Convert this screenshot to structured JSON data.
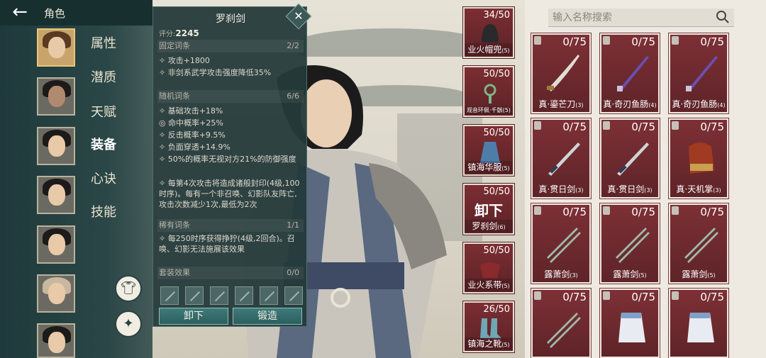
{
  "header": {
    "back_icon": "back-arrow-icon",
    "title": "角色"
  },
  "menu": [
    "属性",
    "潜质",
    "天赋",
    "装备",
    "心诀",
    "技能"
  ],
  "menu_active_index": 3,
  "round_buttons": [
    {
      "icon": "outfit-icon"
    },
    {
      "icon": "broom-icon"
    }
  ],
  "popup": {
    "title": "罗刹剑",
    "score_label": "评分:",
    "score": "2245",
    "fixed": {
      "label": "固定词条",
      "count": "2/2",
      "lines": [
        "攻击+1800",
        "非剑系武学攻击强度降低35%"
      ]
    },
    "random": {
      "label": "随机词条",
      "count": "6/6",
      "lines": [
        "基础攻击+18%",
        "命中概率+25%",
        "反击概率+9.5%",
        "负面穿透+14.9%",
        "50%的概率无视对方21%的防御强度",
        "每第4次攻击将造成诸般封印(4级,100时序)。每有一个非召唤、幻影队友阵亡,攻击次数减少1次,最低为2次"
      ]
    },
    "rare": {
      "label": "稀有词条",
      "count": "1/1",
      "lines": [
        "每250时序获得挣狞(4级,2回合)。召唤、幻影无法施展该效果"
      ]
    },
    "set": {
      "label": "套装效果",
      "count": "0/0"
    },
    "btn_unequip": "卸下",
    "btn_forge": "锻造"
  },
  "equipped": [
    {
      "count": "34/50",
      "name": "业火帽兜",
      "tier": "(5)",
      "icon": "hood-icon"
    },
    {
      "count": "50/50",
      "name": "观音环佩·千骸",
      "tier": "(5)",
      "icon": "pendant-icon"
    },
    {
      "count": "50/50",
      "name": "镇海华服",
      "tier": "(5)",
      "icon": "robe-icon"
    },
    {
      "count": "50/50",
      "name": "罗刹剑",
      "tier": "(6)",
      "overlay": "卸下",
      "icon": "sword-icon"
    },
    {
      "count": "50/50",
      "name": "业火系带",
      "tier": "(5)",
      "icon": "belt-icon"
    },
    {
      "count": "26/50",
      "name": "镇海之靴",
      "tier": "(5)",
      "icon": "boots-icon"
    }
  ],
  "search": {
    "placeholder": "输入名称搜索",
    "icon": "search-icon"
  },
  "inventory": [
    {
      "count": "0/75",
      "name": "真·鎏芒刀",
      "tier": "(3)",
      "icon": "saber-icon"
    },
    {
      "count": "0/75",
      "name": "真·奇刃鱼肠",
      "tier": "(4)",
      "icon": "dagger-icon"
    },
    {
      "count": "0/75",
      "name": "真·奇刃鱼肠",
      "tier": "(4)",
      "icon": "dagger-icon"
    },
    {
      "count": "0/75",
      "name": "真·贯日剑",
      "tier": "(3)",
      "icon": "sword-icon"
    },
    {
      "count": "0/75",
      "name": "真·贯日剑",
      "tier": "(3)",
      "icon": "sword-icon"
    },
    {
      "count": "0/75",
      "name": "真·天机掌",
      "tier": "(3)",
      "icon": "gauntlet-icon"
    },
    {
      "count": "0/75",
      "name": "露萧剑",
      "tier": "(3)",
      "icon": "twin-sword-icon"
    },
    {
      "count": "0/75",
      "name": "露萧剑",
      "tier": "(5)",
      "icon": "twin-sword-icon"
    },
    {
      "count": "0/75",
      "name": "露萧剑",
      "tier": "(5)",
      "icon": "twin-sword-icon"
    },
    {
      "count": "0/75",
      "name": "",
      "tier": "",
      "icon": "twin-sword-icon"
    },
    {
      "count": "0/75",
      "name": "",
      "tier": "",
      "icon": "glove-icon"
    },
    {
      "count": "0/75",
      "name": "",
      "tier": "",
      "icon": "glove-icon"
    }
  ]
}
